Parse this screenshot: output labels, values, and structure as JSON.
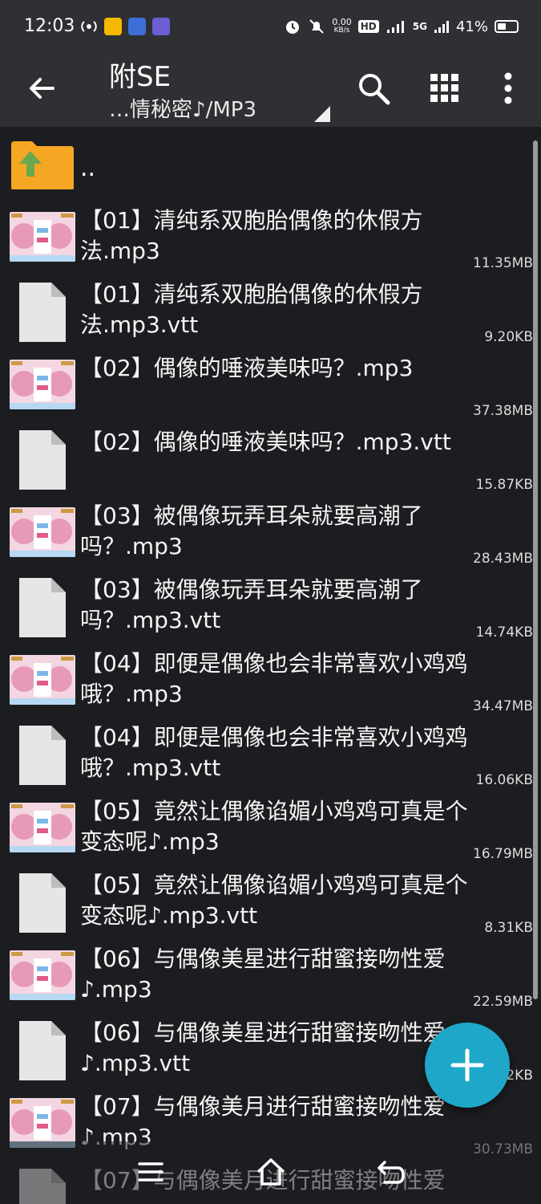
{
  "status_bar": {
    "time": "12:03",
    "net_speed_value": "0.00",
    "net_speed_unit": "KB/s",
    "hd_label": "HD",
    "network_5g": "5G",
    "battery_percent": "41%"
  },
  "toolbar": {
    "title": "附SE",
    "path": "…情秘密♪/MP3",
    "icons": [
      "back-arrow-icon",
      "search-icon",
      "grid-view-icon",
      "more-vert-icon"
    ]
  },
  "list": {
    "parent_label": "..",
    "items": [
      {
        "name": "【01】清纯系双胞胎偶像的休假方法.mp3",
        "size": "11.35MB",
        "kind": "audio"
      },
      {
        "name": "【01】清纯系双胞胎偶像的休假方法.mp3.vtt",
        "size": "9.20KB",
        "kind": "text"
      },
      {
        "name": "【02】偶像的唾液美味吗？.mp3",
        "size": "37.38MB",
        "kind": "audio"
      },
      {
        "name": "【02】偶像的唾液美味吗？.mp3.vtt",
        "size": "15.87KB",
        "kind": "text"
      },
      {
        "name": "【03】被偶像玩弄耳朵就要高潮了吗？.mp3",
        "size": "28.43MB",
        "kind": "audio"
      },
      {
        "name": "【03】被偶像玩弄耳朵就要高潮了吗？.mp3.vtt",
        "size": "14.74KB",
        "kind": "text"
      },
      {
        "name": "【04】即便是偶像也会非常喜欢小鸡鸡哦？.mp3",
        "size": "34.47MB",
        "kind": "audio"
      },
      {
        "name": "【04】即便是偶像也会非常喜欢小鸡鸡哦？.mp3.vtt",
        "size": "16.06KB",
        "kind": "text"
      },
      {
        "name": "【05】竟然让偶像谄媚小鸡鸡可真是个变态呢♪.mp3",
        "size": "16.79MB",
        "kind": "audio"
      },
      {
        "name": "【05】竟然让偶像谄媚小鸡鸡可真是个变态呢♪.mp3.vtt",
        "size": "8.31KB",
        "kind": "text"
      },
      {
        "name": "【06】与偶像美星进行甜蜜接吻性爱♪.mp3",
        "size": "22.59MB",
        "kind": "audio"
      },
      {
        "name": "【06】与偶像美星进行甜蜜接吻性爱♪.mp3.vtt",
        "size": "2KB",
        "kind": "text"
      },
      {
        "name": "【07】与偶像美月进行甜蜜接吻性爱♪.mp3",
        "size": "30.73MB",
        "kind": "audio"
      },
      {
        "name": "【07】与偶像美月进行甜蜜接吻性爱",
        "size": "",
        "kind": "text"
      }
    ]
  },
  "fab": {
    "icon": "plus-icon",
    "color": "#1ea7c8"
  },
  "nav_bar": {
    "icons": [
      "menu-icon",
      "home-icon",
      "back-icon"
    ]
  }
}
